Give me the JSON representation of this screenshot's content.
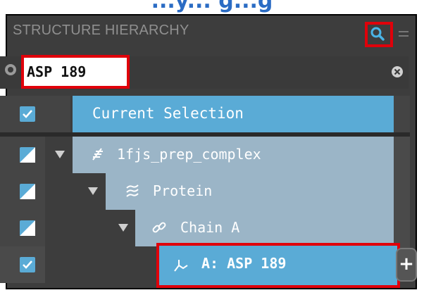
{
  "caption": "...y... g...g",
  "panel": {
    "title": "STRUCTURE HIERARCHY",
    "search_query": "ASP 189",
    "current_selection_label": "Current Selection",
    "add_label": "+"
  },
  "tree": [
    {
      "label": "1fjs_prep_complex",
      "icon": "complex-icon",
      "check": "partial",
      "expanded": true
    },
    {
      "label": "Protein",
      "icon": "protein-helix-icon",
      "check": "partial",
      "expanded": true
    },
    {
      "label": "Chain A",
      "icon": "chain-link-icon",
      "check": "partial",
      "expanded": true
    },
    {
      "label": "A: ASP 189",
      "icon": "residue-icon",
      "check": "checked",
      "selected": true
    }
  ],
  "colors": {
    "panel_bg": "#3d3d3d",
    "selection_blue": "#5aabd6",
    "tree_row": "#9bb5c7",
    "highlight_red": "#e0000a",
    "caption_blue": "#2b6cc4"
  }
}
